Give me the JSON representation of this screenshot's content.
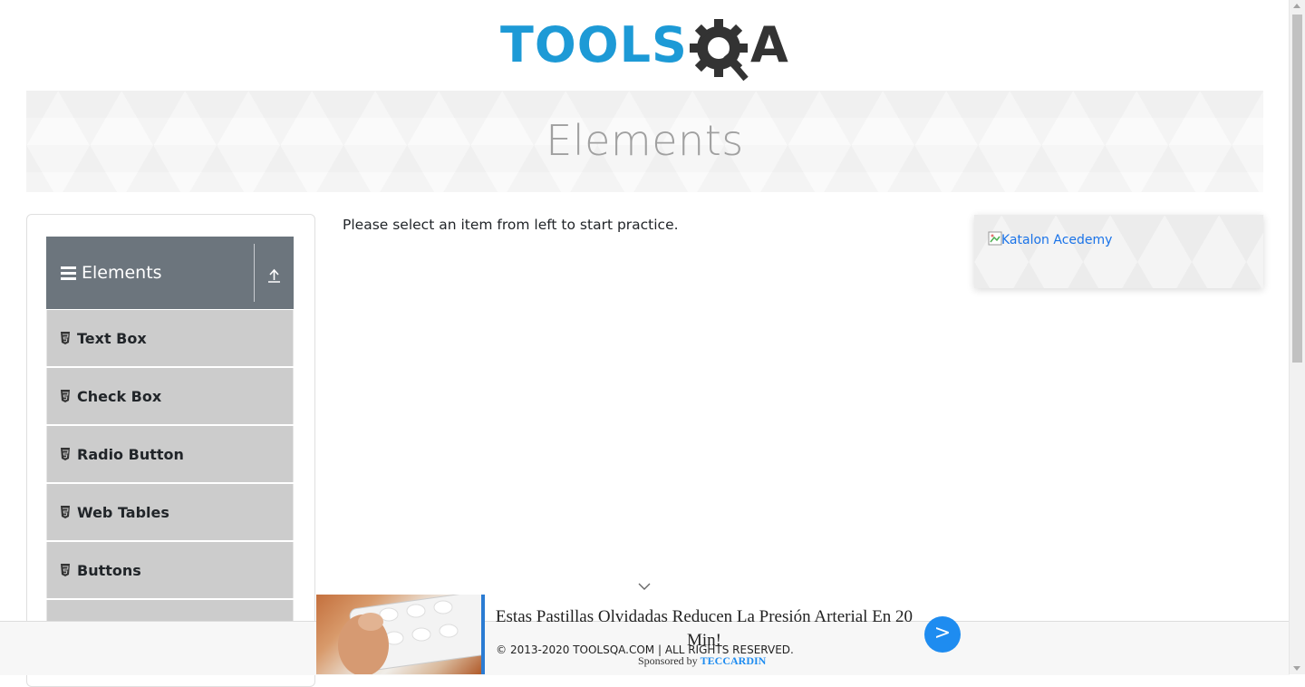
{
  "header": {
    "logo_text_primary": "TOOLS",
    "logo_text_secondary": "QA"
  },
  "banner": {
    "title": "Elements"
  },
  "sidebar": {
    "group_title": "Elements",
    "items": [
      {
        "label": "Text Box"
      },
      {
        "label": "Check Box"
      },
      {
        "label": "Radio Button"
      },
      {
        "label": "Web Tables"
      },
      {
        "label": "Buttons"
      },
      {
        "label": ""
      }
    ]
  },
  "main": {
    "instruction": "Please select an item from left to start practice."
  },
  "right_ad": {
    "alt_text": "Katalon Acedemy"
  },
  "footer": {
    "copyright": "© 2013-2020 TOOLSQA.COM | ALL RIGHTS RESERVED."
  },
  "promo": {
    "headline": "Estas Pastillas Olvidadas Reducen La Presión Arterial En 20 Min!",
    "button_label": ">",
    "sponsor_prefix": "Sponsored by",
    "sponsor_name": "TECCARDIN"
  },
  "colors": {
    "logo_blue": "#1d9ad6",
    "logo_dark": "#333333",
    "group_header_bg": "#6c757d",
    "menu_item_bg": "#cccccc",
    "link_blue": "#1a73e8",
    "promo_button": "#1e8cf0"
  },
  "icons": {
    "menu": "hamburger-icon",
    "collapse": "upload-arrow-icon",
    "item": "html5-shield-icon",
    "chevron": "chevron-down-icon"
  }
}
